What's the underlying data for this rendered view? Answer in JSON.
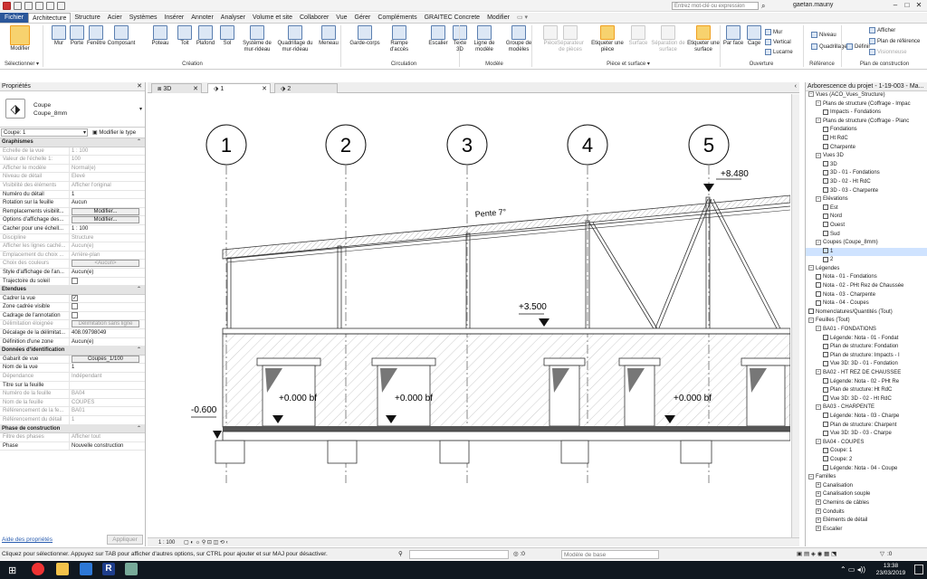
{
  "titlebar": {
    "search_placeholder": "Entrez mot-clé ou expression",
    "user": "gaetan.mauny"
  },
  "menu_tabs": [
    "Fichier",
    "Architecture",
    "Structure",
    "Acier",
    "Systèmes",
    "Insérer",
    "Annoter",
    "Analyser",
    "Volume et site",
    "Collaborer",
    "Vue",
    "Gérer",
    "Compléments",
    "GRAITEC Concrete",
    "Modifier"
  ],
  "ribbon": {
    "modify": "Modifier",
    "select": "Sélectionner",
    "buttons": [
      "Mur",
      "Porte",
      "Fenêtre",
      "Composant",
      "Poteau",
      "Toit",
      "Plafond",
      "Sol",
      "Système de mur-rideau",
      "Quadrillage du mur-rideau",
      "Meneau",
      "Garde-corps",
      "Rampe d'accès",
      "Escalier",
      "Texte 3D",
      "Ligne de modèle",
      "Groupe de modèles",
      "Pièce",
      "Séparateur de pièces",
      "Etiqueter une pièce",
      "Surface",
      "Séparation de surface",
      "Etiqueter une surface",
      "Par face",
      "Cage",
      "Mur",
      "Vertical",
      "Lucarne",
      "Niveau",
      "Quadrillage",
      "Définir",
      "Afficher",
      "Plan de référence",
      "Visionneuse"
    ],
    "groups": [
      "Création",
      "Circulation",
      "Modèle",
      "Pièce et surface ▾",
      "Ouverture",
      "Référence",
      "Plan de construction"
    ]
  },
  "properties": {
    "title": "Propriétés",
    "type_family": "Coupe",
    "type_name": "Coupe_8mm",
    "instance": "Coupe: 1",
    "edit_type": "Modifier le type",
    "graphics_header": "Graphismes",
    "graphics": [
      [
        "Echelle de la vue",
        "1 : 100"
      ],
      [
        "Valeur de l'échelle    1:",
        "100"
      ],
      [
        "Afficher le modèle",
        "Normal(e)"
      ],
      [
        "Niveau de détail",
        "Elevé"
      ],
      [
        "Visibilité des éléments",
        "Afficher l'original"
      ],
      [
        "Numéro du détail",
        "1"
      ],
      [
        "Rotation sur la feuille",
        "Aucun"
      ],
      [
        "Remplacements visibilit...",
        "Modifier..."
      ],
      [
        "Options d'affichage des...",
        "Modifier..."
      ],
      [
        "Cacher pour une échell...",
        "1 : 100"
      ],
      [
        "Discipline",
        "Structure"
      ],
      [
        "Afficher les lignes caché...",
        "Aucun(e)"
      ],
      [
        "Emplacement du choix ...",
        "Arrière-plan"
      ],
      [
        "Choix des couleurs",
        "<Aucun>"
      ],
      [
        "Style d'affichage de l'an...",
        "Aucun(e)"
      ],
      [
        "Trajectoire du soleil",
        ""
      ]
    ],
    "extents_header": "Etendues",
    "extents": [
      [
        "Cadrer la vue",
        "✓"
      ],
      [
        "Zone cadrée visible",
        ""
      ],
      [
        "Cadrage de l'annotation",
        ""
      ],
      [
        "Délimitation éloignée",
        "Délimitation sans ligne"
      ],
      [
        "Décalage de la délimitat...",
        "408.09798049"
      ],
      [
        "Définition d'une zone",
        "Aucun(e)"
      ]
    ],
    "ident_header": "Données d'identification",
    "ident": [
      [
        "Gabarit de vue",
        "Coupes_1/100"
      ],
      [
        "Nom de la vue",
        "1"
      ],
      [
        "Dépendance",
        "Indépendant"
      ],
      [
        "Titre sur la feuille",
        ""
      ],
      [
        "Numéro de la feuille",
        "BA04"
      ],
      [
        "Nom de la feuille",
        "COUPES"
      ],
      [
        "Référencement de la fe...",
        "BA01"
      ],
      [
        "Référencement du détail",
        "1"
      ]
    ],
    "phase_header": "Phase de construction",
    "phase": [
      [
        "Filtre des phases",
        "Afficher tout"
      ],
      [
        "Phase",
        "Nouvelle construction"
      ]
    ],
    "help": "Aide des propriétés",
    "apply": "Appliquer"
  },
  "view_tabs": [
    "3D",
    "1",
    "2"
  ],
  "drawing": {
    "grids": [
      "1",
      "2",
      "3",
      "4",
      "5"
    ],
    "level_top": "+8.480",
    "slope": "Pente 7°",
    "level_mid": "+3.500",
    "level_bf": "+0.000 bf",
    "level_low": "-0.600"
  },
  "viewbar": {
    "scale": "1 : 100"
  },
  "project_browser": {
    "title": "Arborescence du projet - 1-19-003 - Ma...",
    "rows": [
      [
        "0",
        "−",
        "Vues (ACO_Vues_Structure)"
      ],
      [
        "1",
        "−",
        "Plans de structure (Coffrage - Impac"
      ],
      [
        "2",
        "",
        "Impacts - Fondations"
      ],
      [
        "1",
        "−",
        "Plans de structure (Coffrage - Planc"
      ],
      [
        "2",
        "",
        "Fondations"
      ],
      [
        "2",
        "",
        "Ht RdC"
      ],
      [
        "2",
        "",
        "Charpente"
      ],
      [
        "1",
        "−",
        "Vues 3D"
      ],
      [
        "2",
        "",
        "3D"
      ],
      [
        "2",
        "",
        "3D - 01 - Fondations"
      ],
      [
        "2",
        "",
        "3D - 02 - Ht RdC"
      ],
      [
        "2",
        "",
        "3D - 03 - Charpente"
      ],
      [
        "1",
        "−",
        "Elévations"
      ],
      [
        "2",
        "",
        "Est"
      ],
      [
        "2",
        "",
        "Nord"
      ],
      [
        "2",
        "",
        "Ouest"
      ],
      [
        "2",
        "",
        "Sud"
      ],
      [
        "1",
        "−",
        "Coupes (Coupe_8mm)"
      ],
      [
        "2",
        "",
        "1"
      ],
      [
        "2",
        "",
        "2"
      ],
      [
        "0",
        "−",
        "Légendes"
      ],
      [
        "1",
        "",
        "Nota - 01 - Fondations"
      ],
      [
        "1",
        "",
        "Nota - 02 - PHt Rez de Chaussée"
      ],
      [
        "1",
        "",
        "Nota - 03 - Charpente"
      ],
      [
        "1",
        "",
        "Nota - 04 - Coupes"
      ],
      [
        "0",
        "",
        "Nomenclatures/Quantités (Tout)"
      ],
      [
        "0",
        "−",
        "Feuilles (Tout)"
      ],
      [
        "1",
        "−",
        "BA01 - FONDATIONS"
      ],
      [
        "2",
        "",
        "Légende: Nota - 01 - Fondat"
      ],
      [
        "2",
        "",
        "Plan de structure: Fondation"
      ],
      [
        "2",
        "",
        "Plan de structure: Impacts - I"
      ],
      [
        "2",
        "",
        "Vue 3D: 3D - 01 - Fondation"
      ],
      [
        "1",
        "−",
        "BA02 - HT REZ DE CHAUSSEE"
      ],
      [
        "2",
        "",
        "Légende: Nota - 02 - PHt Re"
      ],
      [
        "2",
        "",
        "Plan de structure: Ht RdC"
      ],
      [
        "2",
        "",
        "Vue 3D: 3D - 02 - Ht RdC"
      ],
      [
        "1",
        "−",
        "BA03 - CHARPENTE"
      ],
      [
        "2",
        "",
        "Légende: Nota - 03 - Charpe"
      ],
      [
        "2",
        "",
        "Plan de structure: Charpent"
      ],
      [
        "2",
        "",
        "Vue 3D: 3D - 03 - Charpe"
      ],
      [
        "1",
        "−",
        "BA04 - COUPES"
      ],
      [
        "2",
        "",
        "Coupe: 1"
      ],
      [
        "2",
        "",
        "Coupe: 2"
      ],
      [
        "2",
        "",
        "Légende: Nota - 04 - Coupe"
      ],
      [
        "0",
        "−",
        "Familles"
      ],
      [
        "1",
        "+",
        "Canalisation"
      ],
      [
        "1",
        "+",
        "Canalisation souple"
      ],
      [
        "1",
        "+",
        "Chemins de câbles"
      ],
      [
        "1",
        "+",
        "Conduits"
      ],
      [
        "1",
        "+",
        "Eléments de détail"
      ],
      [
        "1",
        "+",
        "Escalier"
      ]
    ]
  },
  "status": {
    "message": "Cliquez pour sélectionner. Appuyez sur TAB pour afficher d'autres options, sur CTRL pour ajouter et sur MAJ pour désactiver.",
    "model": "Modèle de base",
    "zero": ":0"
  },
  "taskbar": {
    "time": "13:38",
    "date": "23/03/2019"
  }
}
